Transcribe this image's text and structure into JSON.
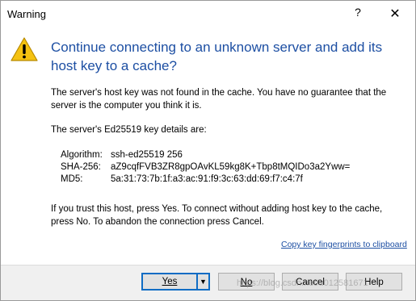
{
  "window": {
    "title": "Warning",
    "help_glyph": "?",
    "close_glyph": "✕"
  },
  "icon": "warning-icon",
  "heading": "Continue connecting to an unknown server and add its host key to a cache?",
  "paragraph1": "The server's host key was not found in the cache. You have no guarantee that the server is the computer you think it is.",
  "paragraph2": "The server's Ed25519 key details are:",
  "details": [
    {
      "label": "Algorithm:",
      "value": "ssh-ed25519 256"
    },
    {
      "label": "SHA-256:",
      "value": "aZ9cqfFVB3ZR8gpOAvKL59kg8K+Tbp8tMQIDo3a2Yww="
    },
    {
      "label": "MD5:",
      "value": "5a:31:73:7b:1f:a3:ac:91:f9:3c:63:dd:69:f7:c4:7f"
    }
  ],
  "paragraph3": "If you trust this host, press Yes. To connect without adding host key to the cache, press No. To abandon the connection press Cancel.",
  "copy_link": "Copy key fingerprints to clipboard",
  "buttons": {
    "yes": "Yes",
    "yes_arrow": "▼",
    "no": "No",
    "cancel": "Cancel",
    "help": "Help"
  },
  "watermark": "https://blog.csdn.net/u012581671",
  "colors": {
    "heading": "#1d4fa3",
    "link": "#1d4fa3",
    "default_button_border": "#0f6cc4",
    "warning_fill": "#f5c211"
  }
}
